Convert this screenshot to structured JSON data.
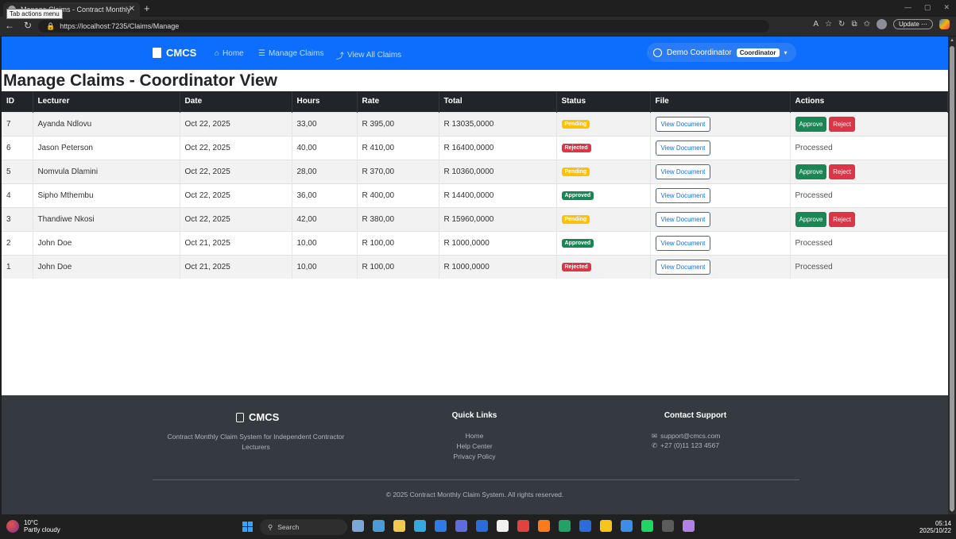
{
  "browser": {
    "tab_title": "Manage Claims - Contract Monthly",
    "tab_tooltip": "Tab actions menu",
    "close_glyph": "✕",
    "new_tab_glyph": "+",
    "url": "https://localhost:7235/Claims/Manage",
    "update_label": "Update",
    "more_glyph": "⋯",
    "window_controls": [
      "—",
      "▢",
      "✕"
    ]
  },
  "nav": {
    "brand": "CMCS",
    "links": [
      {
        "icon": "home-icon",
        "glyph": "⌂",
        "label": "Home"
      },
      {
        "icon": "list-icon",
        "glyph": "☰",
        "label": "Manage Claims"
      },
      {
        "icon": "chart-icon",
        "glyph": "⤴",
        "label": "View All Claims"
      }
    ],
    "user_name": "Demo Coordinator",
    "role": "Coordinator"
  },
  "page": {
    "title": "Manage Claims - Coordinator View"
  },
  "table": {
    "headers": [
      "ID",
      "Lecturer",
      "Date",
      "Hours",
      "Rate",
      "Total",
      "Status",
      "File",
      "Actions"
    ],
    "rows": [
      {
        "id": "7",
        "lecturer": "Ayanda Ndlovu",
        "date": "Oct 22, 2025",
        "hours": "33,00",
        "rate": "R 395,00",
        "total": "R 13035,0000",
        "status": "Pending",
        "file": "View Document",
        "action": "buttons"
      },
      {
        "id": "6",
        "lecturer": "Jason Peterson",
        "date": "Oct 22, 2025",
        "hours": "40,00",
        "rate": "R 410,00",
        "total": "R 16400,0000",
        "status": "Rejected",
        "file": "View Document",
        "action": "Processed"
      },
      {
        "id": "5",
        "lecturer": "Nomvula Dlamini",
        "date": "Oct 22, 2025",
        "hours": "28,00",
        "rate": "R 370,00",
        "total": "R 10360,0000",
        "status": "Pending",
        "file": "View Document",
        "action": "buttons"
      },
      {
        "id": "4",
        "lecturer": "Sipho Mthembu",
        "date": "Oct 22, 2025",
        "hours": "36,00",
        "rate": "R 400,00",
        "total": "R 14400,0000",
        "status": "Approved",
        "file": "View Document",
        "action": "Processed"
      },
      {
        "id": "3",
        "lecturer": "Thandiwe Nkosi",
        "date": "Oct 22, 2025",
        "hours": "42,00",
        "rate": "R 380,00",
        "total": "R 15960,0000",
        "status": "Pending",
        "file": "View Document",
        "action": "buttons"
      },
      {
        "id": "2",
        "lecturer": "John Doe",
        "date": "Oct 21, 2025",
        "hours": "10,00",
        "rate": "R 100,00",
        "total": "R 1000,0000",
        "status": "Approved",
        "file": "View Document",
        "action": "Processed"
      },
      {
        "id": "1",
        "lecturer": "John Doe",
        "date": "Oct 21, 2025",
        "hours": "10,00",
        "rate": "R 100,00",
        "total": "R 1000,0000",
        "status": "Rejected",
        "file": "View Document",
        "action": "Processed"
      }
    ],
    "approve_label": "Approve",
    "reject_label": "Reject"
  },
  "footer": {
    "brand": "CMCS",
    "description": "Contract Monthly Claim System for Independent Contractor Lecturers",
    "quick_links_title": "Quick Links",
    "quick_links": [
      "Home",
      "Help Center",
      "Privacy Policy"
    ],
    "contact_title": "Contact Support",
    "email": "support@cmcs.com",
    "phone": "+27 (0)11 123 4567",
    "copyright": "© 2025 Contract Monthly Claim System. All rights reserved."
  },
  "taskbar": {
    "temperature": "10°C",
    "weather": "Partly cloudy",
    "search_label": "Search",
    "time": "05:14",
    "date": "2025/10/22",
    "app_colors": [
      "#7aa7d8",
      "#4a9bd6",
      "#f2c94c",
      "#35a8e0",
      "#2f7be5",
      "#5d6dde",
      "#2b6cdb",
      "#f0f0f0",
      "#e0423d",
      "#ff7a1a",
      "#21a366",
      "#2b6cdb",
      "#f6c41a",
      "#3c8de6",
      "#1ed760",
      "#5c5c5c",
      "#b181e8"
    ]
  }
}
